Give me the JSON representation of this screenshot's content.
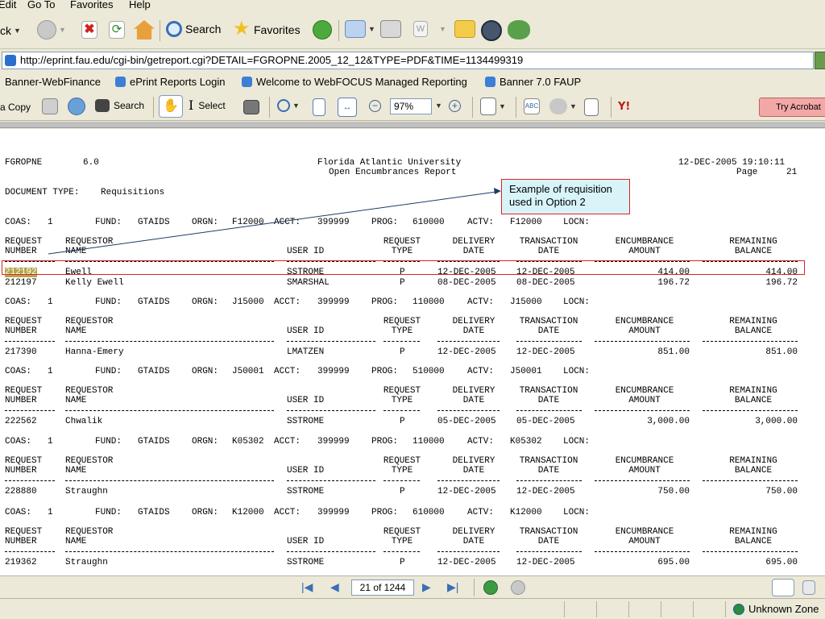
{
  "menubar": [
    "Edit",
    "Go To",
    "Favorites",
    "Help"
  ],
  "toolbar": {
    "back_label": "ck",
    "search_label": "Search",
    "favorites_label": "Favorites"
  },
  "address": {
    "url": "http://eprint.fau.edu/cgi-bin/getreport.cgi?DETAIL=FGROPNE.2005_12_12&TYPE=PDF&TIME=1134499319"
  },
  "links": [
    "Banner-WebFinance",
    "ePrint Reports Login",
    "Welcome to WebFOCUS Managed Reporting",
    "Banner 7.0 FAUP"
  ],
  "pdf_toolbar": {
    "save_copy_label": "a Copy",
    "search_label": "Search",
    "select_label": "Select",
    "zoom_value": "97%",
    "try_acrobat_label": "Try Acrobat"
  },
  "report": {
    "form_id": "FGROPNE",
    "version": "6.0",
    "university": "Florida Atlantic University",
    "report_title": "Open Encumbrances Report",
    "run_datetime": "12-DEC-2005 19:10:11",
    "page_label": "Page",
    "page_number": "21",
    "document_type_label": "DOCUMENT TYPE:",
    "document_type": "Requisitions",
    "col_headers": {
      "request_number": [
        "REQUEST",
        "NUMBER"
      ],
      "requestor_name": [
        "REQUESTOR",
        "NAME"
      ],
      "user_id": [
        "",
        "USER ID"
      ],
      "request_type": [
        "REQUEST",
        "TYPE"
      ],
      "delivery_date": [
        "DELIVERY",
        "DATE"
      ],
      "transaction_date": [
        "TRANSACTION",
        "DATE"
      ],
      "encumbrance_amount": [
        "ENCUMBRANCE",
        "AMOUNT"
      ],
      "remaining_balance": [
        "REMAINING",
        "BALANCE"
      ]
    },
    "sections": [
      {
        "coas": "1",
        "fund": "GTAIDS",
        "orgn": "F12000",
        "acct": "399999",
        "prog": "610000",
        "actv": "F12000",
        "locn": "",
        "rows": [
          {
            "number": "212192",
            "name": "Ewell",
            "user_id": "SSTROME",
            "type": "P",
            "delivery": "12-DEC-2005",
            "transaction": "12-DEC-2005",
            "amount": "414.00",
            "balance": "414.00"
          },
          {
            "number": "212197",
            "name": "Kelly Ewell",
            "user_id": "SMARSHAL",
            "type": "P",
            "delivery": "08-DEC-2005",
            "transaction": "08-DEC-2005",
            "amount": "196.72",
            "balance": "196.72"
          }
        ]
      },
      {
        "coas": "1",
        "fund": "GTAIDS",
        "orgn": "J15000",
        "acct": "399999",
        "prog": "110000",
        "actv": "J15000",
        "locn": "",
        "rows": [
          {
            "number": "217390",
            "name": "Hanna-Emery",
            "user_id": "LMATZEN",
            "type": "P",
            "delivery": "12-DEC-2005",
            "transaction": "12-DEC-2005",
            "amount": "851.00",
            "balance": "851.00"
          }
        ]
      },
      {
        "coas": "1",
        "fund": "GTAIDS",
        "orgn": "J50001",
        "acct": "399999",
        "prog": "510000",
        "actv": "J50001",
        "locn": "",
        "rows": [
          {
            "number": "222562",
            "name": "Chwalik",
            "user_id": "SSTROME",
            "type": "P",
            "delivery": "05-DEC-2005",
            "transaction": "05-DEC-2005",
            "amount": "3,000.00",
            "balance": "3,000.00"
          }
        ]
      },
      {
        "coas": "1",
        "fund": "GTAIDS",
        "orgn": "K05302",
        "acct": "399999",
        "prog": "110000",
        "actv": "K05302",
        "locn": "",
        "rows": [
          {
            "number": "228880",
            "name": "Straughn",
            "user_id": "SSTROME",
            "type": "P",
            "delivery": "12-DEC-2005",
            "transaction": "12-DEC-2005",
            "amount": "750.00",
            "balance": "750.00"
          }
        ]
      },
      {
        "coas": "1",
        "fund": "GTAIDS",
        "orgn": "K12000",
        "acct": "399999",
        "prog": "610000",
        "actv": "K12000",
        "locn": "",
        "rows": [
          {
            "number": "219362",
            "name": "Straughn",
            "user_id": "SSTROME",
            "type": "P",
            "delivery": "12-DEC-2005",
            "transaction": "12-DEC-2005",
            "amount": "695.00",
            "balance": "695.00"
          }
        ]
      }
    ],
    "labels": {
      "coas": "COAS:",
      "fund": "FUND:",
      "orgn": "ORGN:",
      "acct": "ACCT:",
      "prog": "PROG:",
      "actv": "ACTV:",
      "locn": "LOCN:"
    }
  },
  "annotation": {
    "line1": "Example of requisition",
    "line2": "used in Option 2"
  },
  "nav": {
    "page_indicator": "21 of 1244"
  },
  "status": {
    "zone": "Unknown Zone"
  },
  "colors": {
    "annotation_border": "#dd2222",
    "annotation_fill": "#d8f4f8",
    "highlight": "#b5a54a"
  }
}
